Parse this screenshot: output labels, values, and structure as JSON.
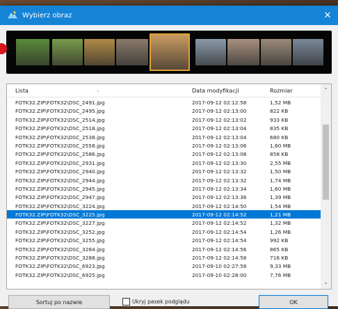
{
  "window": {
    "title": "Wybierz obraz",
    "close_glyph": "✕"
  },
  "list": {
    "columns": {
      "name": "Lista",
      "date": "Data modyfikacji",
      "size": "Rozmiar"
    },
    "rows": [
      {
        "name": "FOTK32.ZIP\\FOTK32\\DSC_2491.jpg",
        "date": "2017-09-12 02:12:58",
        "size": "1,52 MB"
      },
      {
        "name": "FOTK32.ZIP\\FOTK32\\DSC_2495.jpg",
        "date": "2017-09-12 02:13:00",
        "size": "822 KB"
      },
      {
        "name": "FOTK32.ZIP\\FOTK32\\DSC_2514.jpg",
        "date": "2017-09-12 02:13:02",
        "size": "933 KB"
      },
      {
        "name": "FOTK32.ZIP\\FOTK32\\DSC_2518.jpg",
        "date": "2017-09-12 02:13:04",
        "size": "835 KB"
      },
      {
        "name": "FOTK32.ZIP\\FOTK32\\DSC_2538.jpg",
        "date": "2017-09-12 02:13:04",
        "size": "680 KB"
      },
      {
        "name": "FOTK32.ZIP\\FOTK32\\DSC_2558.jpg",
        "date": "2017-09-12 02:13:06",
        "size": "1,60 MB"
      },
      {
        "name": "FOTK32.ZIP\\FOTK32\\DSC_2586.jpg",
        "date": "2017-09-12 02:13:08",
        "size": "858 KB"
      },
      {
        "name": "FOTK32.ZIP\\FOTK32\\DSC_2931.jpg",
        "date": "2017-09-12 02:13:30",
        "size": "2,55 MB"
      },
      {
        "name": "FOTK32.ZIP\\FOTK32\\DSC_2940.jpg",
        "date": "2017-09-12 02:13:32",
        "size": "1,50 MB"
      },
      {
        "name": "FOTK32.ZIP\\FOTK32\\DSC_2944.jpg",
        "date": "2017-09-12 02:13:32",
        "size": "1,74 MB"
      },
      {
        "name": "FOTK32.ZIP\\FOTK32\\DSC_2945.jpg",
        "date": "2017-09-12 02:13:34",
        "size": "1,60 MB"
      },
      {
        "name": "FOTK32.ZIP\\FOTK32\\DSC_2947.jpg",
        "date": "2017-09-12 02:13:36",
        "size": "1,39 MB"
      },
      {
        "name": "FOTK32.ZIP\\FOTK32\\DSC_3224.jpg",
        "date": "2017-09-12 02:14:50",
        "size": "1,54 MB"
      },
      {
        "name": "FOTK32.ZIP\\FOTK32\\DSC_3225.jpg",
        "date": "2017-09-12 02:14:52",
        "size": "1,21 MB"
      },
      {
        "name": "FOTK32.ZIP\\FOTK32\\DSC_3227.jpg",
        "date": "2017-09-12 02:14:52",
        "size": "1,32 MB"
      },
      {
        "name": "FOTK32.ZIP\\FOTK32\\DSC_3252.jpg",
        "date": "2017-09-12 02:14:54",
        "size": "1,26 MB"
      },
      {
        "name": "FOTK32.ZIP\\FOTK32\\DSC_3255.jpg",
        "date": "2017-09-12 02:14:54",
        "size": "992 KB"
      },
      {
        "name": "FOTK32.ZIP\\FOTK32\\DSC_3264.jpg",
        "date": "2017-09-12 02:14:56",
        "size": "865 KB"
      },
      {
        "name": "FOTK32.ZIP\\FOTK32\\DSC_3288.jpg",
        "date": "2017-09-12 02:14:58",
        "size": "716 KB"
      },
      {
        "name": "FOTK32.ZIP\\FOTK32\\DSC_6923.jpg",
        "date": "2017-09-10 02:27:58",
        "size": "9,33 MB"
      },
      {
        "name": "FOTK32.ZIP\\FOTK32\\DSC_6925.jpg",
        "date": "2017-09-10 02:28:00",
        "size": "7,76 MB"
      }
    ],
    "selected_index": 13
  },
  "filmstrip": {
    "thumbnail_colors": [
      "#5a8a3a",
      "#7a9a4a",
      "#b08a48",
      "#8a7a6a",
      "#c89a60",
      "#8a9aa8",
      "#a89080",
      "#9a8a7a",
      "#7a8898"
    ],
    "selected_index": 4
  },
  "footer": {
    "sort_button": "Sortuj po nazwie",
    "hide_preview_label": "Ukryj pasek podglądu",
    "hide_preview_checked": false,
    "ok_button": "OK"
  },
  "colors": {
    "titlebar": "#1583d6",
    "selection": "#0078d7",
    "thumb_highlight": "#e1a238"
  }
}
